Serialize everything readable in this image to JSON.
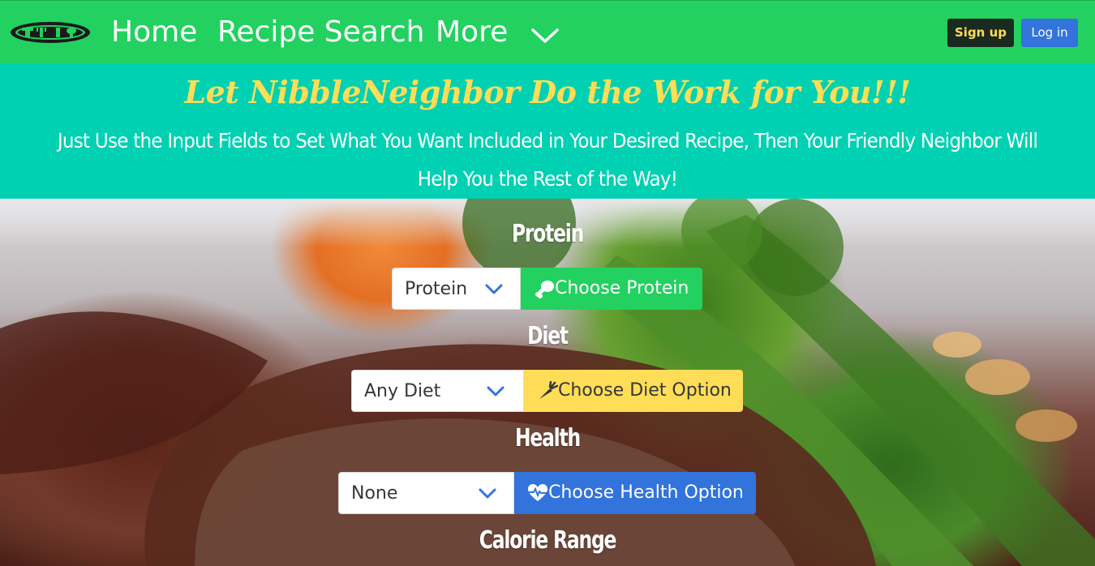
{
  "navbar": {
    "logo_icon": "utensils-logo-icon",
    "links": [
      "Home",
      "Recipe Search",
      "More"
    ],
    "more_icon": "chevron-down-icon",
    "signup_label": "Sign up",
    "login_label": "Log in",
    "colors": {
      "bar": "#23d160",
      "signup_bg": "#1a2a1f",
      "signup_text": "#ffdd57",
      "login_bg": "#3273dc"
    }
  },
  "hero": {
    "title": "Let NibbleNeighbor Do the Work for You!!!",
    "subtitle": "Just Use the Input Fields to Set What You Want Included in Your Desired Recipe, Then Your Friendly Neighbor Will Help You the Rest of the Way!",
    "colors": {
      "background": "#00d1b2",
      "title": "#ffdd57",
      "subtitle": "#ffffff"
    }
  },
  "form": {
    "protein": {
      "label": "Protein",
      "select_value": "Protein",
      "button_label": "Choose Protein",
      "button_icon": "drumstick-icon",
      "button_color": "#23d160"
    },
    "diet": {
      "label": "Diet",
      "select_value": "Any Diet",
      "button_label": "Choose Diet Option",
      "button_icon": "carrot-icon",
      "button_color": "#ffdd57"
    },
    "health": {
      "label": "Health",
      "select_value": "None",
      "button_label": "Choose Health Option",
      "button_icon": "heartbeat-icon",
      "button_color": "#3273dc"
    },
    "calories": {
      "label": "Calorie Range"
    }
  }
}
